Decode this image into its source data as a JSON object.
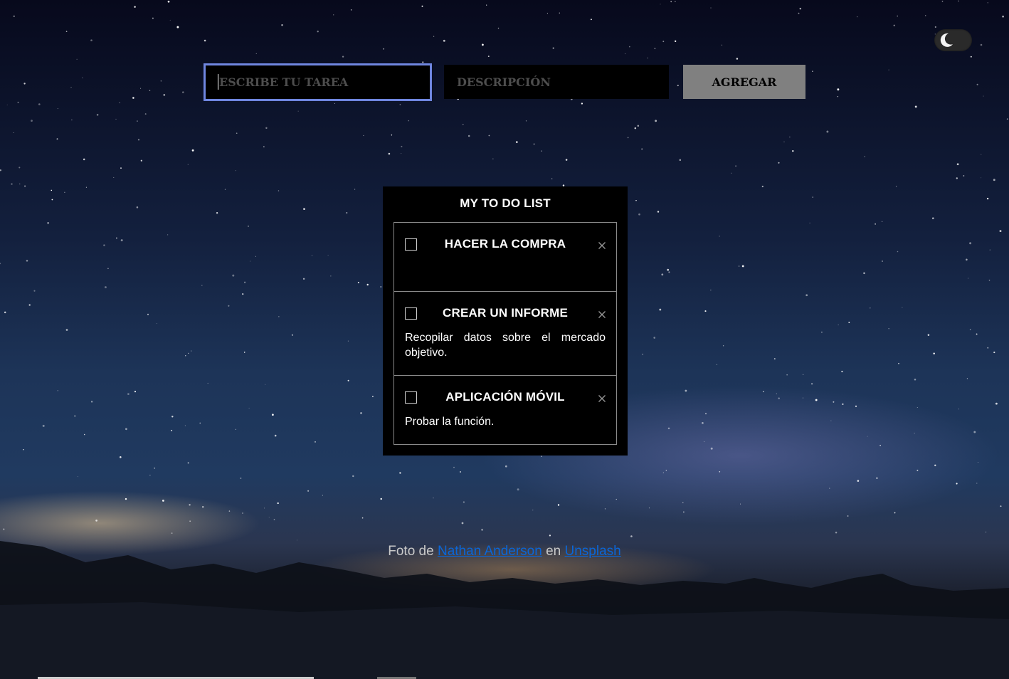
{
  "form": {
    "task_placeholder": "ESCRIBE TU TAREA",
    "task_value": "",
    "description_placeholder": "DESCRIPCIÓN",
    "description_value": "",
    "add_label": "AGREGAR"
  },
  "theme_toggle": {
    "icon": "moon-icon",
    "state": "dark"
  },
  "todo": {
    "title": "MY TO DO LIST",
    "items": [
      {
        "title": "HACER LA COMPRA",
        "description": "",
        "done": false
      },
      {
        "title": "CREAR UN INFORME",
        "description": "Recopilar datos sobre el mercado objetivo.",
        "done": false
      },
      {
        "title": "APLICACIÓN MÓVIL",
        "description": "Probar la función.",
        "done": false
      }
    ]
  },
  "credit": {
    "prefix": "Foto de",
    "author": "Nathan Anderson",
    "middle": "en",
    "site": "Unsplash"
  },
  "colors": {
    "focus_border": "#6f86e0",
    "button_bg": "#808080",
    "link": "#0a66d8",
    "card_bg": "#000000"
  }
}
